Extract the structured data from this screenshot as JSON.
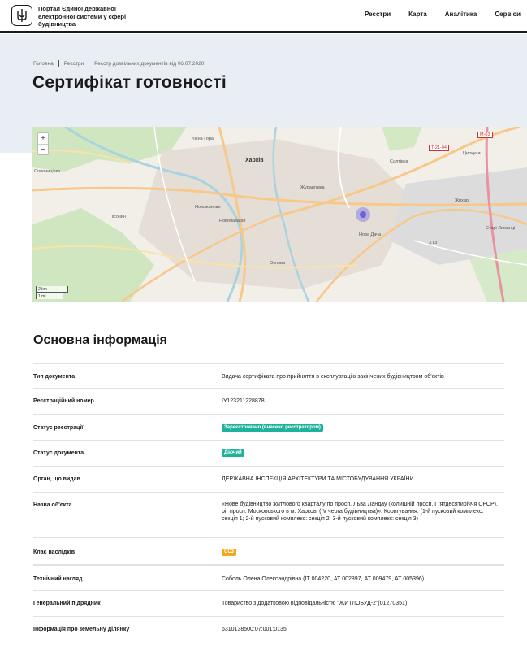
{
  "header": {
    "logo_text": "Портал Єдиної державної електронної системи у сфері будівництва",
    "nav": [
      "Реєстри",
      "Карта",
      "Аналітика",
      "Сервіси"
    ]
  },
  "breadcrumb": [
    "Головна",
    "Реєстри",
    "Реєстр дозвільних документів від 06.07.2020"
  ],
  "page_title": "Сертифікат готовності",
  "map": {
    "zoom_in": "+",
    "zoom_out": "−",
    "scale_km": "2 km",
    "scale_mi": "1 mi",
    "labels": {
      "kharkiv": "Харків",
      "lisna": "Лісна Гора",
      "solonytsivka": "Солоницівка",
      "pisochyn": "Пісочин",
      "novozhanove": "Новожанове",
      "zhuravlivka": "Журавлівка",
      "novobavariya": "Новобаварія",
      "osnova": "Основа",
      "nova_bavariya": "Нова Дача",
      "khtz": "ХТЗ",
      "stari_zalyutyne": "Старі Лиманці",
      "zhylyi": "Жихар",
      "tsyrkuny": "Циркуни",
      "saltivka": "Салтівка",
      "m03": "M-03",
      "t2104": "T-21-04"
    }
  },
  "section_title": "Основна інформація",
  "rows": [
    {
      "label": "Тип документа",
      "value": "Видача сертифіката про прийняття в експлуатацію закінчених будівництвом об'єктів"
    },
    {
      "label": "Реєстраційний номер",
      "value": "ІУ123211228878"
    },
    {
      "label": "Статус реєстрації",
      "badge": "Зареєстровано (внесено реєстратором)"
    },
    {
      "label": "Статус документа",
      "badge": "Діючий"
    },
    {
      "label": "Орган, що видав",
      "value": "ДЕРЖАВНА ІНСПЕКЦІЯ АРХІТЕКТУРИ ТА МІСТОБУДУВАННЯ УКРАЇНИ"
    },
    {
      "label": "Назва об'єкта",
      "value": "«Нове будівництво житлового кварталу по просп. Льва Ландау (колишній просп. П'ятдесятиріччя СРСР), ріг просп. Московського в м. Харкові (IV черга будівництва)». Коригування. (1-й пусковий комплекс: секція 1; 2-й пусковий комплекс: секція 2; 3-й пусковий комплекс: секція 3)"
    },
    {
      "label": "Клас наслідків",
      "badge": "СС3"
    },
    {
      "label": "Технічний нагляд",
      "value": "Соболь Олена Олександрівна (ІТ 004220, АТ 002897, АТ 009479, АТ 005396)"
    },
    {
      "label": "Генеральний підрядник",
      "value": "Товариство з додатковою відповідальністю \"ЖИТЛОБУД-2\"(01270351)"
    },
    {
      "label": "Інформація про земельну ділянку",
      "value": "6310138500:07:001:0135"
    }
  ],
  "colors": {
    "badge_green": "#1fb29a",
    "badge_orange": "#f2a81c",
    "hero_bg": "#e9eef5",
    "marker": "#6d5fe0"
  }
}
